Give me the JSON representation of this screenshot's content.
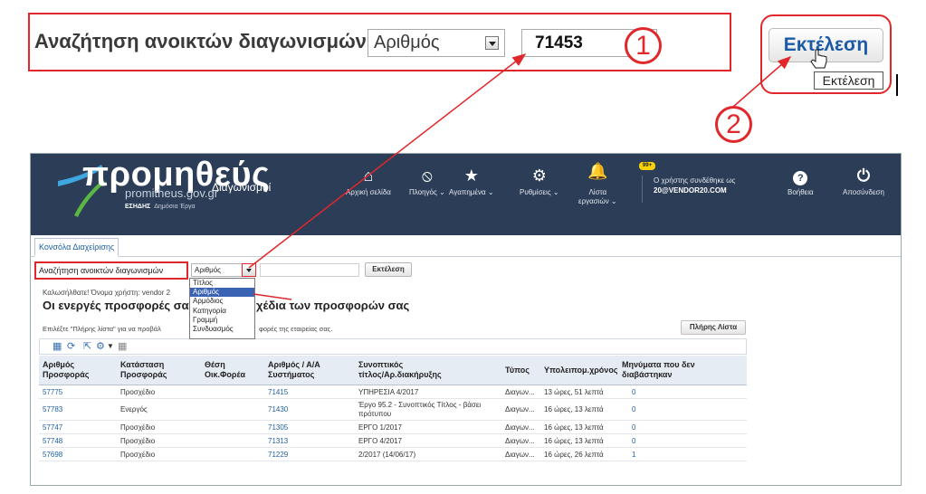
{
  "callout": {
    "search_label": "Αναζήτηση ανοικτών διαγωνισμών",
    "search_by_value": "Αριθμός",
    "search_value": "71453",
    "execute_label": "Εκτέλεση",
    "tooltip": "Εκτέλεση",
    "step1": "1",
    "step2": "2"
  },
  "header": {
    "logo_text": "προμηθεύς",
    "logo_url": "promitheus.gov.gr",
    "logo_tag_bold": "ΕΣΗΔΗΣ",
    "logo_tag": "Δημόσια Έργα",
    "app_name": "Διαγωνισμοί",
    "nav": [
      {
        "label": "Αρχική σελίδα",
        "icon": "home-icon"
      },
      {
        "label": "Πλοηγός",
        "icon": "compass-icon"
      },
      {
        "label": "Αγαπημένα",
        "icon": "star-icon"
      },
      {
        "label": "Ρυθμίσεις",
        "icon": "gear-icon"
      },
      {
        "label": "Λίστα",
        "label2": "εργασιών",
        "icon": "bell-icon",
        "badge": "99+"
      },
      {
        "label": "Βοήθεια",
        "icon": "help-icon"
      },
      {
        "label": "Αποσύνδεση",
        "icon": "power-icon"
      }
    ],
    "user_line1": "Ο χρήστης συνδέθηκε ως",
    "user_line2": "20@VENDOR20.COM"
  },
  "tabs": {
    "active": "Κονσόλα Διαχείρισης"
  },
  "search": {
    "label": "Αναζήτηση ανοικτών διαγωνισμών",
    "select_value": "Αριθμός",
    "execute_label": "Εκτέλεση",
    "options": [
      "Τίτλος",
      "Αριθμός",
      "Αρμόδιος",
      "Κατηγορία",
      "Γραμμή",
      "Συνδυασμός"
    ],
    "selected_option": "Αριθμός"
  },
  "welcome": "Καλωσήλθατε! Όνομα χρήστη: vendor 2",
  "heading_left": "Οι ενεργές προσφορές σας",
  "heading_right": "χέδια των προσφορών σας",
  "info_left": "Επιλέξτε \"Πλήρης λίστα\" για να προβάλ",
  "info_right": "φορές της εταιρείας σας.",
  "full_list_label": "Πλήρης Λίστα",
  "table": {
    "headers": {
      "c1a": "Αριθμός",
      "c1b": "Προσφοράς",
      "c2a": "Κατάσταση",
      "c2b": "Προσφοράς",
      "c3a": "Θέση",
      "c3b": "Οικ.Φορέα",
      "c4a": "Αριθμός / Α/Α",
      "c4b": "Συστήματος",
      "c5a": "Συνοπτικός",
      "c5b": "τίτλος/Αρ.διακήρυξης",
      "c6": "Τύπος",
      "c7": "Υπολειπομ.χρόνος",
      "c8a": "Μηνύματα που δεν",
      "c8b": "διαβάστηκαν"
    },
    "rows": [
      {
        "num": "57775",
        "status": "Προσχέδιο",
        "pos": "",
        "sys": "71415",
        "title": "ΥΠΗΡΕΣΙΑ 4/2017",
        "title2": "",
        "type": "Διαγων...",
        "time": "13 ώρες, 51 λεπτά",
        "msgs": "0"
      },
      {
        "num": "57783",
        "status": "Ενεργός",
        "pos": "",
        "sys": "71430",
        "title": "Έργο 95.2 - Συνοπτικός Τίτλος - βάσει",
        "title2": "πρότυπου",
        "type": "Διαγων...",
        "time": "16 ώρες, 13 λεπτά",
        "msgs": "0"
      },
      {
        "num": "57747",
        "status": "Προσχέδιο",
        "pos": "",
        "sys": "71305",
        "title": "ΕΡΓΟ 1/2017",
        "title2": "",
        "type": "Διαγων...",
        "time": "16 ώρες, 13 λεπτά",
        "msgs": "0"
      },
      {
        "num": "57748",
        "status": "Προσχέδιο",
        "pos": "",
        "sys": "71313",
        "title": "ΕΡΓΟ 4/2017",
        "title2": "",
        "type": "Διαγων...",
        "time": "16 ώρες, 13 λεπτά",
        "msgs": "0"
      },
      {
        "num": "57698",
        "status": "Προσχέδιο",
        "pos": "",
        "sys": "71229",
        "title": "2/2017 (14/06/17)",
        "title2": "",
        "type": "Διαγων...",
        "time": "16 ώρες, 26 λεπτά",
        "msgs": "1"
      }
    ]
  },
  "colors": {
    "annotation": "#e0272b",
    "header_bg": "#2b3d57",
    "link": "#1f5fa3"
  }
}
